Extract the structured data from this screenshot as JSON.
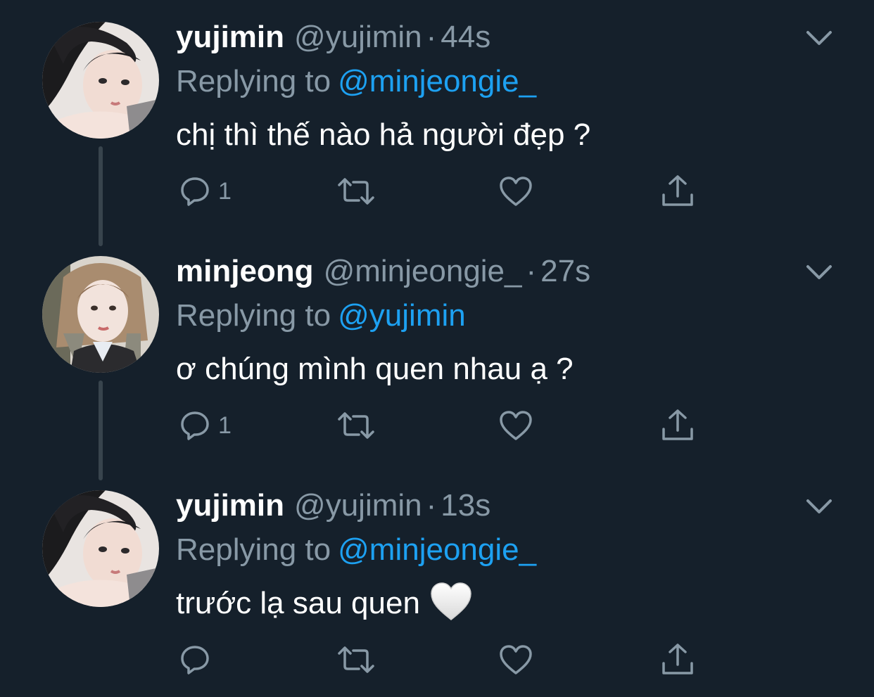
{
  "colors": {
    "background": "#15202b",
    "primary_text": "#ffffff",
    "secondary_text": "#8899a6",
    "link": "#1da1f2",
    "thread_line": "#38444d"
  },
  "tweets": [
    {
      "display_name": "yujimin",
      "handle": "@yujimin",
      "separator": "·",
      "time": "44s",
      "replying_label": "Replying to",
      "replying_to": "@minjeongie_",
      "text": "chị thì thế nào hả người đẹp ?",
      "emoji": "",
      "reply_count": "1",
      "avatar_icon": "profile-photo-yujimin"
    },
    {
      "display_name": "minjeong",
      "handle": "@minjeongie_",
      "separator": "·",
      "time": "27s",
      "replying_label": "Replying to",
      "replying_to": "@yujimin",
      "text": "ơ chúng mình quen nhau ạ ?",
      "emoji": "",
      "reply_count": "1",
      "avatar_icon": "profile-photo-minjeong"
    },
    {
      "display_name": "yujimin",
      "handle": "@yujimin",
      "separator": "·",
      "time": "13s",
      "replying_label": "Replying to",
      "replying_to": "@minjeongie_",
      "text": "trước lạ sau quen",
      "emoji": "white-heart",
      "reply_count": "",
      "avatar_icon": "profile-photo-yujimin"
    }
  ],
  "action_icons": [
    "reply-icon",
    "retweet-icon",
    "like-icon",
    "share-icon"
  ]
}
